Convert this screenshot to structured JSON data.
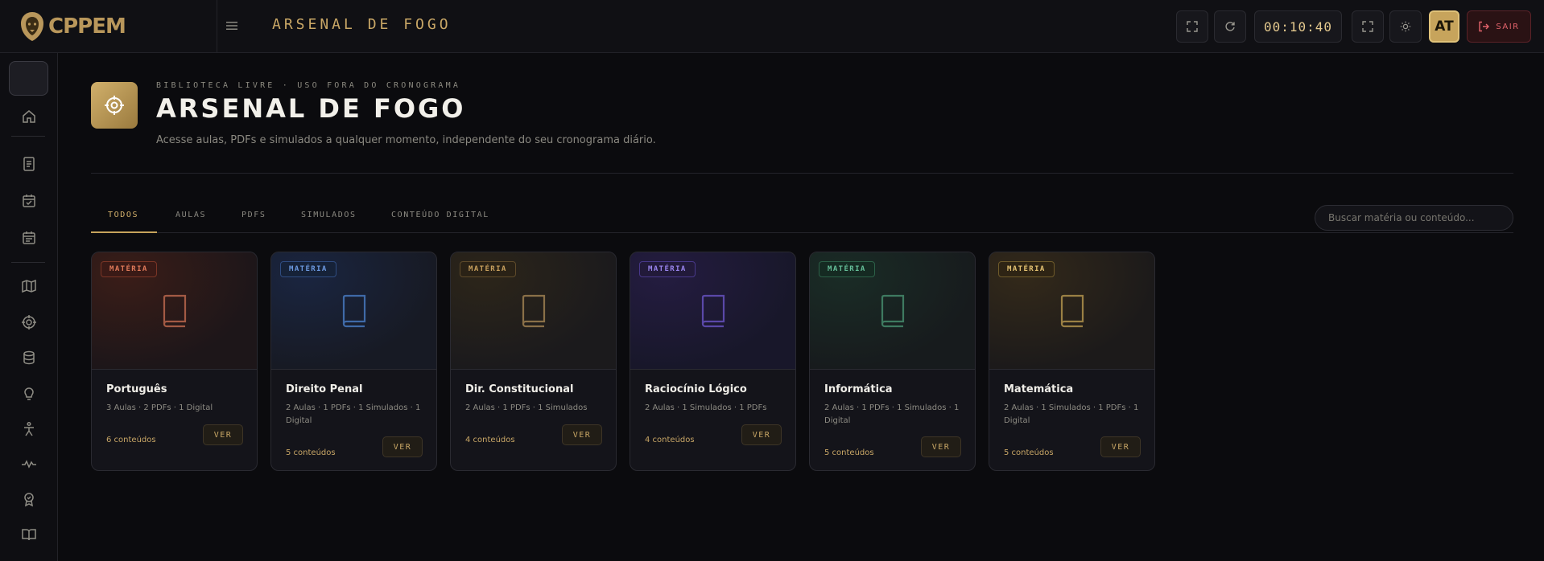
{
  "brand": {
    "name": "CPPEM"
  },
  "header": {
    "title": "ARSENAL DE FOGO",
    "timer": "00:10:40",
    "avatar_initials": "AT",
    "exit_label": "SAIR"
  },
  "page": {
    "eyebrow": "BIBLIOTECA LIVRE · USO FORA DO CRONOGRAMA",
    "title": "ARSENAL DE FOGO",
    "subtitle": "Acesse aulas, PDFs e simulados a qualquer momento, independente do seu cronograma diário."
  },
  "tabs": [
    {
      "label": "TODOS",
      "active": true
    },
    {
      "label": "AULAS",
      "active": false
    },
    {
      "label": "PDFS",
      "active": false
    },
    {
      "label": "SIMULADOS",
      "active": false
    },
    {
      "label": "CONTEÚDO DIGITAL",
      "active": false
    }
  ],
  "search": {
    "placeholder": "Buscar matéria ou conteúdo..."
  },
  "cards": [
    {
      "badge": "MATÉRIA",
      "name": "Português",
      "meta": "3 Aulas · 2 PDFs · 1 Digital",
      "count": "6 conteúdos",
      "button": "VER",
      "accent": "#c06a4e"
    },
    {
      "badge": "MATÉRIA",
      "name": "Direito Penal",
      "meta": "2 Aulas · 1 PDFs · 1 Simulados · 1 Digital",
      "count": "5 conteúdos",
      "button": "VER",
      "accent": "#4f7fc9"
    },
    {
      "badge": "MATÉRIA",
      "name": "Dir. Constitucional",
      "meta": "2 Aulas · 1 PDFs · 1 Simulados",
      "count": "4 conteúdos",
      "button": "VER",
      "accent": "#a88752"
    },
    {
      "badge": "MATÉRIA",
      "name": "Raciocínio Lógico",
      "meta": "2 Aulas · 1 Simulados · 1 PDFs",
      "count": "4 conteúdos",
      "button": "VER",
      "accent": "#6a5ac9"
    },
    {
      "badge": "MATÉRIA",
      "name": "Informática",
      "meta": "2 Aulas · 1 PDFs · 1 Simulados · 1 Digital",
      "count": "5 conteúdos",
      "button": "VER",
      "accent": "#4e9a78"
    },
    {
      "badge": "MATÉRIA",
      "name": "Matemática",
      "meta": "2 Aulas · 1 Simulados · 1 PDFs · 1 Digital",
      "count": "5 conteúdos",
      "button": "VER",
      "accent": "#c9a44e"
    }
  ],
  "colors": {
    "accent_gold": "#c7a45c",
    "background": "#0b0b0e",
    "danger": "#e2636b"
  },
  "sidebar_icons": [
    "home-icon",
    "document-icon",
    "calendar-check-icon",
    "calendar-list-icon",
    "map-icon",
    "target-icon",
    "database-icon",
    "lightbulb-icon",
    "figure-icon",
    "activity-icon",
    "award-icon",
    "book-open-icon"
  ]
}
